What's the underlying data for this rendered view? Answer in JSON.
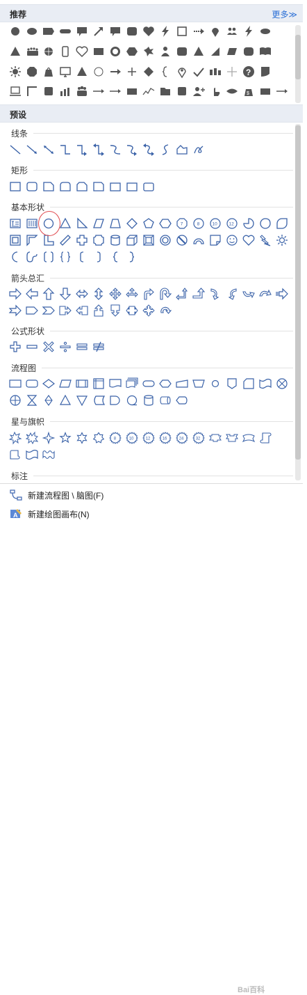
{
  "header": {
    "title": "推荐",
    "more_label": "更多≫"
  },
  "preset_header": {
    "title": "预设"
  },
  "categories": {
    "lines": "线条",
    "rect": "矩形",
    "basic": "基本形状",
    "arrows": "箭头总汇",
    "formula": "公式形状",
    "flowchart": "流程图",
    "stars": "星与旗帜",
    "callouts": "标注"
  },
  "footer": {
    "new_flowchart": "新建流程图 \\ 脑图(F)",
    "new_canvas": "新建绘图画布(N)"
  },
  "watermark": "Bai百科",
  "colors": {
    "accent": "#2a6fd6",
    "shape_gray": "#555555",
    "outline_blue": "#3a62a8",
    "highlight": "#e0474c"
  }
}
